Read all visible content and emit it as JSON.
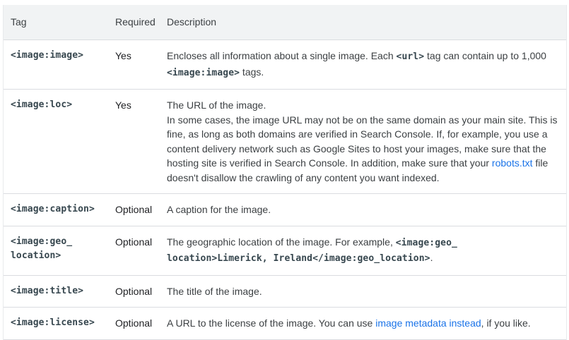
{
  "header": {
    "tag": "Tag",
    "required": "Required",
    "description": "Description"
  },
  "rows": [
    {
      "tag": "<image:image>",
      "required": "Yes",
      "desc": {
        "p1": "Encloses all information about a single image. Each ",
        "code1": "<url>",
        "p2": " tag can contain up to 1,000 ",
        "code2": "<image:image>",
        "p3": " tags."
      }
    },
    {
      "tag": "<image:loc>",
      "required": "Yes",
      "desc": {
        "line1": "The URL of the image.",
        "p1": "In some cases, the image URL may not be on the same domain as your main site. This is fine, as long as both domains are verified in Search Console. If, for example, you use a content delivery network such as Google Sites to host your images, make sure that the hosting site is verified in Search Console. In addition, make sure that your ",
        "link": "robots.txt",
        "p2": " file doesn't disallow the crawling of any content you want indexed."
      }
    },
    {
      "tag": "<image:caption>",
      "required": "Optional",
      "desc": {
        "p1": "A caption for the image."
      }
    },
    {
      "tag": "<image:geo_\nlocation>",
      "required": "Optional",
      "desc": {
        "p1": "The geographic location of the image. For example, ",
        "code1": "<image:geo_ location>Limerick, Ireland</image:geo_location>",
        "p2": "."
      }
    },
    {
      "tag": "<image:title>",
      "required": "Optional",
      "desc": {
        "p1": "The title of the image."
      }
    },
    {
      "tag": "<image:license>",
      "required": "Optional",
      "desc": {
        "p1": "A URL to the license of the image. You can use ",
        "link": "image metadata instead",
        "p2": ", if you like."
      }
    }
  ],
  "colors": {
    "header_bg": "#f1f3f4",
    "link": "#1a73e8",
    "border": "#dadce0",
    "code": "#37474f"
  }
}
